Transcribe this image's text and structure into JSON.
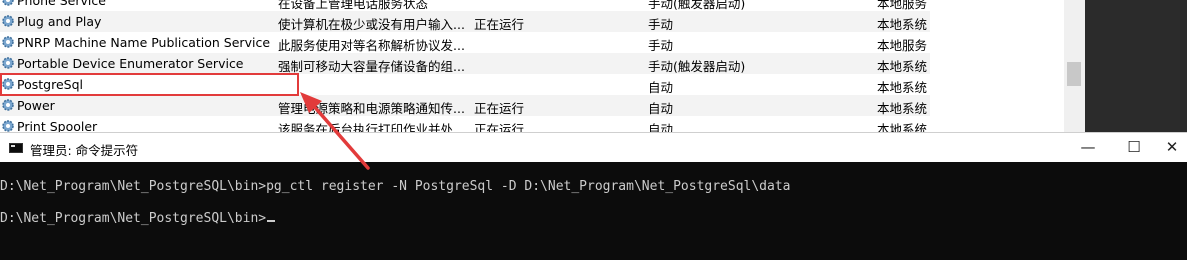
{
  "services": {
    "rows": [
      {
        "name": "Phone Service",
        "description": "在设备上管理电话服务状态",
        "status": "",
        "startup": "手动(触发器启动)",
        "logon": "本地服务"
      },
      {
        "name": "Plug and Play",
        "description": "使计算机在极少或没有用户输入...",
        "status": "正在运行",
        "startup": "手动",
        "logon": "本地系统"
      },
      {
        "name": "PNRP Machine Name Publication Service",
        "description": "此服务使用对等名称解析协议发...",
        "status": "",
        "startup": "手动",
        "logon": "本地服务"
      },
      {
        "name": "Portable Device Enumerator Service",
        "description": "强制可移动大容量存储设备的组...",
        "status": "",
        "startup": "手动(触发器启动)",
        "logon": "本地系统"
      },
      {
        "name": "PostgreSql",
        "description": "",
        "status": "",
        "startup": "自动",
        "logon": "本地系统"
      },
      {
        "name": "Power",
        "description": "管理电源策略和电源策略通知传...",
        "status": "正在运行",
        "startup": "自动",
        "logon": "本地系统"
      },
      {
        "name": "Print Spooler",
        "description": "该服务在后台执行打印作业并处...",
        "status": "正在运行",
        "startup": "自动",
        "logon": "本地系统"
      }
    ],
    "selected_row": "PostgreSql"
  },
  "cmd_window": {
    "title": "管理员: 命令提示符",
    "minimize_glyph": "—",
    "maximize_glyph": "☐",
    "close_glyph": "✕",
    "line1": "D:\\Net_Program\\Net_PostgreSQL\\bin>pg_ctl register -N PostgreSql -D D:\\Net_Program\\Net_PostgreSql\\data",
    "line2": "D:\\Net_Program\\Net_PostgreSQL\\bin>"
  },
  "colors": {
    "highlight": "#e23b3b",
    "console_bg": "#0c0c0c",
    "console_text": "#cccccc"
  },
  "icons": {
    "service": "gear-icon",
    "cmd": "cmd-icon",
    "annotation": "arrow-icon"
  }
}
